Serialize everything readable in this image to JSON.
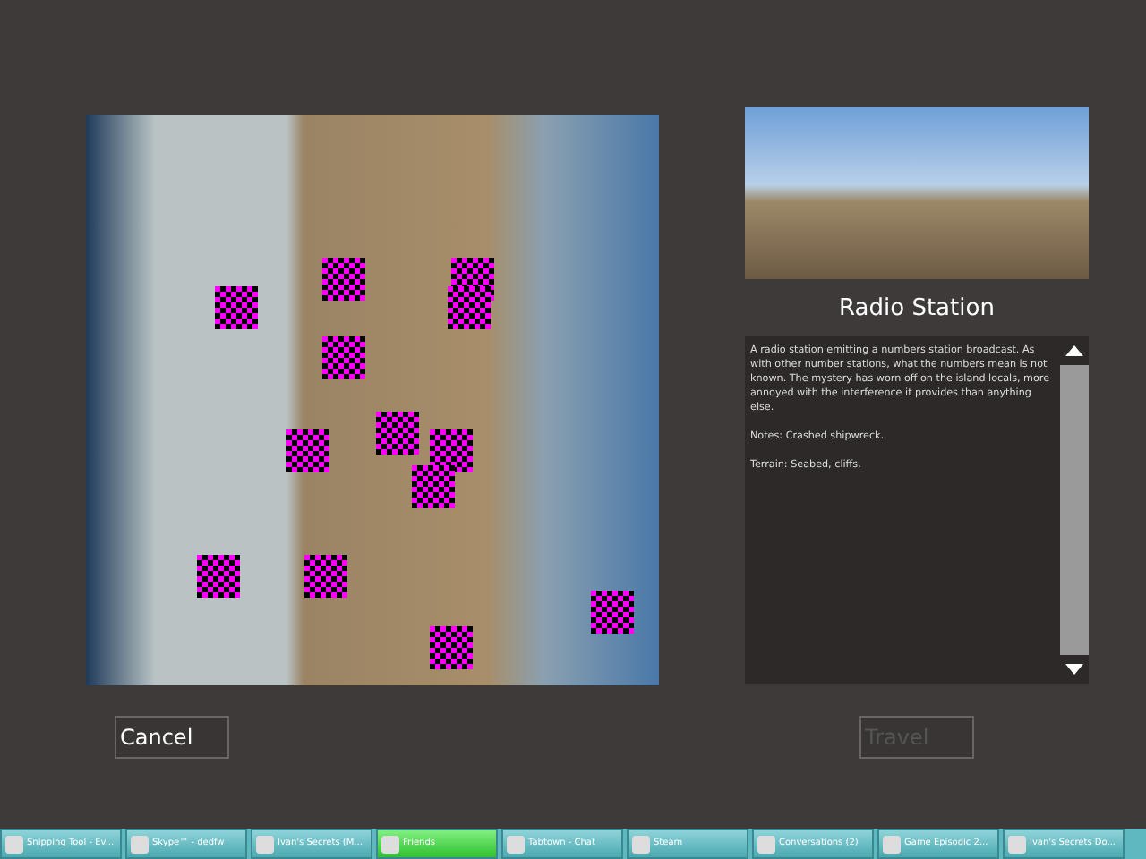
{
  "location": {
    "title": "Radio Station",
    "description": "A radio station emitting a numbers station broadcast. As with other number stations, what the numbers mean is not known. The mystery has worn off on the island locals, more annoyed with the interference it provides than anything else.",
    "notes": "Notes: Crashed shipwreck.",
    "terrain": "Terrain: Seabed, cliffs."
  },
  "buttons": [
    {
      "label": "Cancel",
      "disabled": false
    },
    {
      "label": "Travel",
      "disabled": true
    }
  ],
  "taskbar": [
    {
      "label": "Snipping Tool - Ev...",
      "selected": false
    },
    {
      "label": "Skype™ - dedfw",
      "selected": false
    },
    {
      "label": "Ivan's Secrets (M...",
      "selected": false
    },
    {
      "label": "Friends",
      "selected": true
    },
    {
      "label": "Tabtown - Chat",
      "selected": false
    },
    {
      "label": "Steam",
      "selected": false
    },
    {
      "label": "Conversations (2)",
      "selected": false
    },
    {
      "label": "Game Episodic 2...",
      "selected": false
    },
    {
      "label": "Ivan's Secrets Do...",
      "selected": false
    }
  ]
}
